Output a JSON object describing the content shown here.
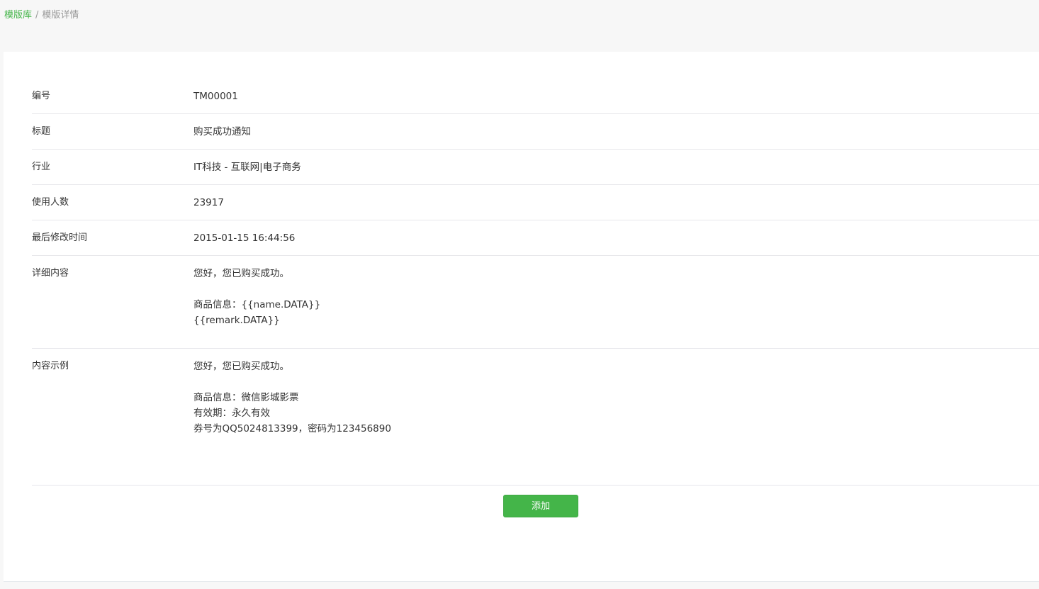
{
  "breadcrumb": {
    "root": "模版库",
    "separator": "/",
    "current": "模版详情"
  },
  "details": {
    "number": {
      "label": "编号",
      "value": "TM00001"
    },
    "title": {
      "label": "标题",
      "value": "购买成功通知"
    },
    "industry": {
      "label": "行业",
      "value": "IT科技 - 互联网|电子商务"
    },
    "users": {
      "label": "使用人数",
      "value": "23917"
    },
    "modified": {
      "label": "最后修改时间",
      "value": "2015-01-15 16:44:56"
    },
    "content": {
      "label": "详细内容",
      "lines": [
        "您好，您已购买成功。",
        "",
        "商品信息：{{name.DATA}}",
        "{{remark.DATA}}"
      ]
    },
    "example": {
      "label": "内容示例",
      "lines": [
        "您好，您已购买成功。",
        "",
        "商品信息：微信影城影票",
        "有效期：永久有效",
        "券号为QQ5024813399，密码为123456890"
      ]
    }
  },
  "actions": {
    "add_label": "添加"
  },
  "colors": {
    "accent": "#44b549",
    "background": "#f7f7f7",
    "panel": "#ffffff",
    "divider": "#e7e7eb"
  }
}
